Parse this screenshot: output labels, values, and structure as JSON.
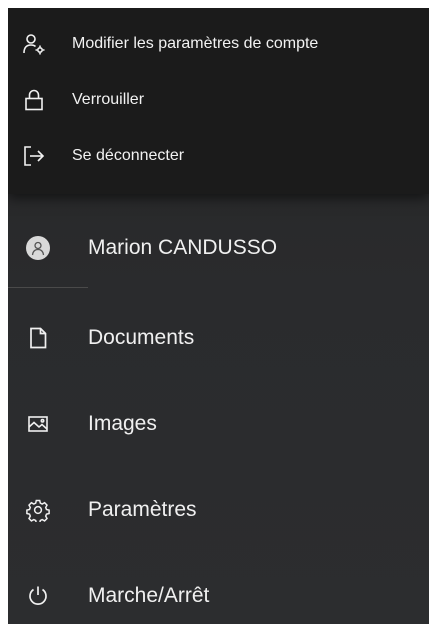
{
  "flyout": {
    "items": [
      {
        "label": "Modifier les paramètres de compte",
        "icon": "account-settings-icon"
      },
      {
        "label": "Verrouiller",
        "icon": "lock-icon"
      },
      {
        "label": "Se déconnecter",
        "icon": "sign-out-icon"
      }
    ]
  },
  "menu": {
    "user": {
      "label": "Marion CANDUSSO",
      "icon": "user-avatar-icon"
    },
    "items": [
      {
        "label": "Documents",
        "icon": "document-icon"
      },
      {
        "label": "Images",
        "icon": "image-icon"
      },
      {
        "label": "Paramètres",
        "icon": "gear-icon"
      },
      {
        "label": "Marche/Arrêt",
        "icon": "power-icon"
      }
    ]
  },
  "colors": {
    "flyout_bg": "#1b1b1b",
    "menu_bg": "#2a2b2d",
    "text": "#f0f0f0"
  }
}
